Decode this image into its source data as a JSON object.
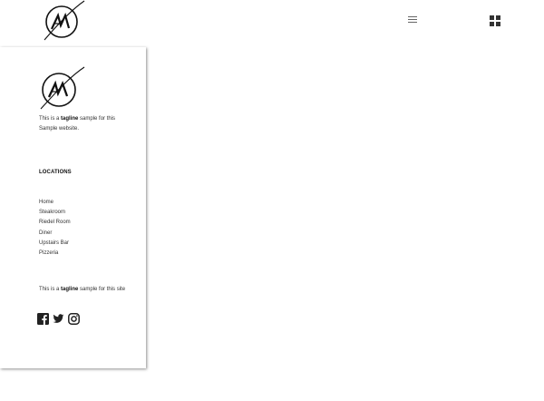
{
  "header": {
    "logo_icon": "am-logo-icon",
    "menu_icon": "hamburger-menu-icon",
    "grid_icon": "grid-view-icon"
  },
  "sidebar": {
    "logo_icon": "am-logo-icon",
    "tagline_top": {
      "pre": "This is a ",
      "bold": "tagline",
      "post": " sample for this Sample website."
    },
    "locations_heading": "LOCATIONS",
    "nav_items": [
      "Home",
      "Steakroom",
      "Riedel Room",
      "Diner",
      "Upstairs Bar",
      "Pizzeria"
    ],
    "tagline_bottom": {
      "pre": "This is a ",
      "bold": "tagline",
      "post": " sample for this site"
    },
    "social_icons": [
      "facebook-icon",
      "twitter-icon",
      "instagram-icon"
    ]
  }
}
